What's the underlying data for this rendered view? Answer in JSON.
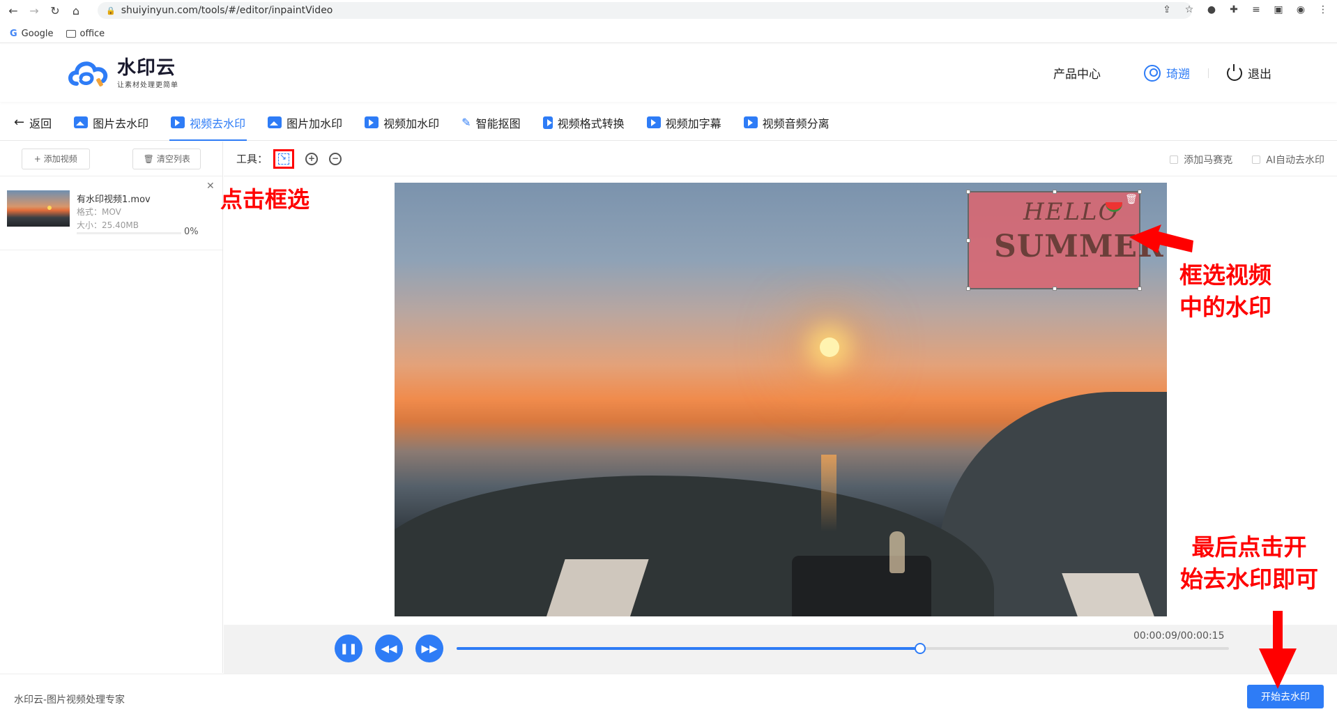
{
  "browser": {
    "url": "shuiyinyun.com/tools/#/editor/inpaintVideo",
    "bookmarks": [
      "Google",
      "office"
    ]
  },
  "header": {
    "logo_title": "水印云",
    "logo_sub": "让素材处理更简单",
    "product_center": "产品中心",
    "username": "琦遡",
    "logout": "退出"
  },
  "toolnav": {
    "back": "返回",
    "items": [
      "图片去水印",
      "视频去水印",
      "图片加水印",
      "视频加水印",
      "智能抠图",
      "视频格式转换",
      "视频加字幕",
      "视频音频分离"
    ],
    "active_index": 1
  },
  "left_panel": {
    "add_video": "添加视频",
    "clear_list": "清空列表",
    "file": {
      "name": "有水印视频1.mov",
      "format": "格式：MOV",
      "size": "大小：25.40MB",
      "progress": "0%"
    }
  },
  "toolbar": {
    "label": "工具：",
    "mosaic": "添加马赛克",
    "ai_auto": "AI自动去水印"
  },
  "video": {
    "watermark_line1": "HELLO",
    "watermark_line2": "SUMMER"
  },
  "player": {
    "time": "00:00:09/00:00:15",
    "progress": 0.6
  },
  "footer": {
    "text": "水印云-图片视频处理专家",
    "start_button": "开始去水印"
  },
  "annotations": {
    "click_select": "点击框选",
    "select_wm_line1": "框选视频",
    "select_wm_line2": "中的水印",
    "final_line1": "最后点击开",
    "final_line2": "始去水印即可"
  },
  "colors": {
    "accent": "#2e7cf6",
    "annotation": "#ff0000"
  }
}
